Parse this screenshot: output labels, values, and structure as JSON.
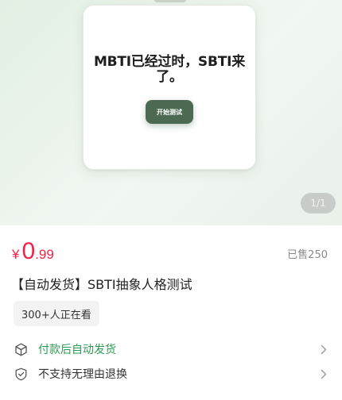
{
  "hero": {
    "card_title": "MBTI已经过时，SBTI来了。",
    "start_button": "开始测试",
    "pager": "1/1"
  },
  "product": {
    "price_symbol": "¥",
    "price_integer": "0",
    "price_decimal": ".99",
    "sold": "已售250",
    "title": "【自动发货】SBTI抽象人格测试",
    "viewers": "300+人正在看"
  },
  "services": [
    {
      "label": "付款后自动发货",
      "icon": "cube-icon",
      "color": "#2c9a52"
    },
    {
      "label": "不支持无理由退换",
      "icon": "shield-check-icon",
      "color": "#333333"
    }
  ],
  "colors": {
    "price": "#f0244a",
    "button": "#4c6a52",
    "hero_bg": "#e6f0e6"
  }
}
